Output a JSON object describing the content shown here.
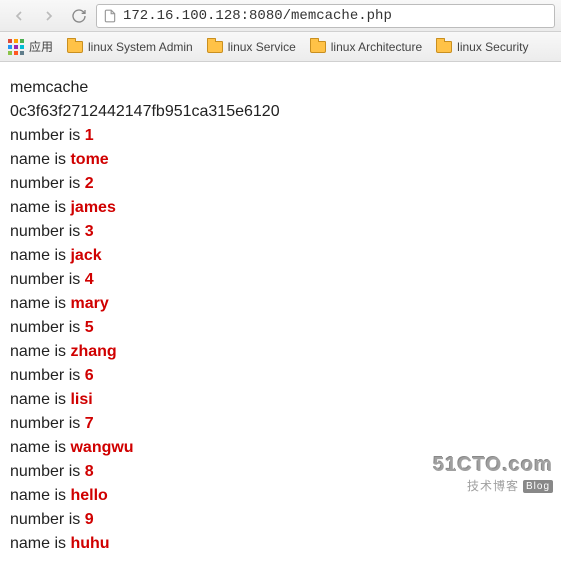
{
  "nav": {
    "url_host": "172.16.100.128",
    "url_rest": ":8080/memcache.php"
  },
  "bookmarks": {
    "apps_label": "应用",
    "items": [
      {
        "label": "linux System Admin"
      },
      {
        "label": "linux Service"
      },
      {
        "label": "linux Architecture"
      },
      {
        "label": "linux Security"
      }
    ]
  },
  "page": {
    "title_line": "memcache",
    "hash_line": "0c3f63f2712442147fb951ca315e6120",
    "entries": [
      {
        "number": "1",
        "name": "tome"
      },
      {
        "number": "2",
        "name": "james"
      },
      {
        "number": "3",
        "name": "jack"
      },
      {
        "number": "4",
        "name": "mary"
      },
      {
        "number": "5",
        "name": "zhang"
      },
      {
        "number": "6",
        "name": "lisi"
      },
      {
        "number": "7",
        "name": "wangwu"
      },
      {
        "number": "8",
        "name": "hello"
      },
      {
        "number": "9",
        "name": "huhu"
      }
    ],
    "number_prefix": "number is ",
    "name_prefix": "name is "
  },
  "watermark": {
    "line1": "51CTO.com",
    "line2": "技术博客",
    "blog": "Blog"
  }
}
